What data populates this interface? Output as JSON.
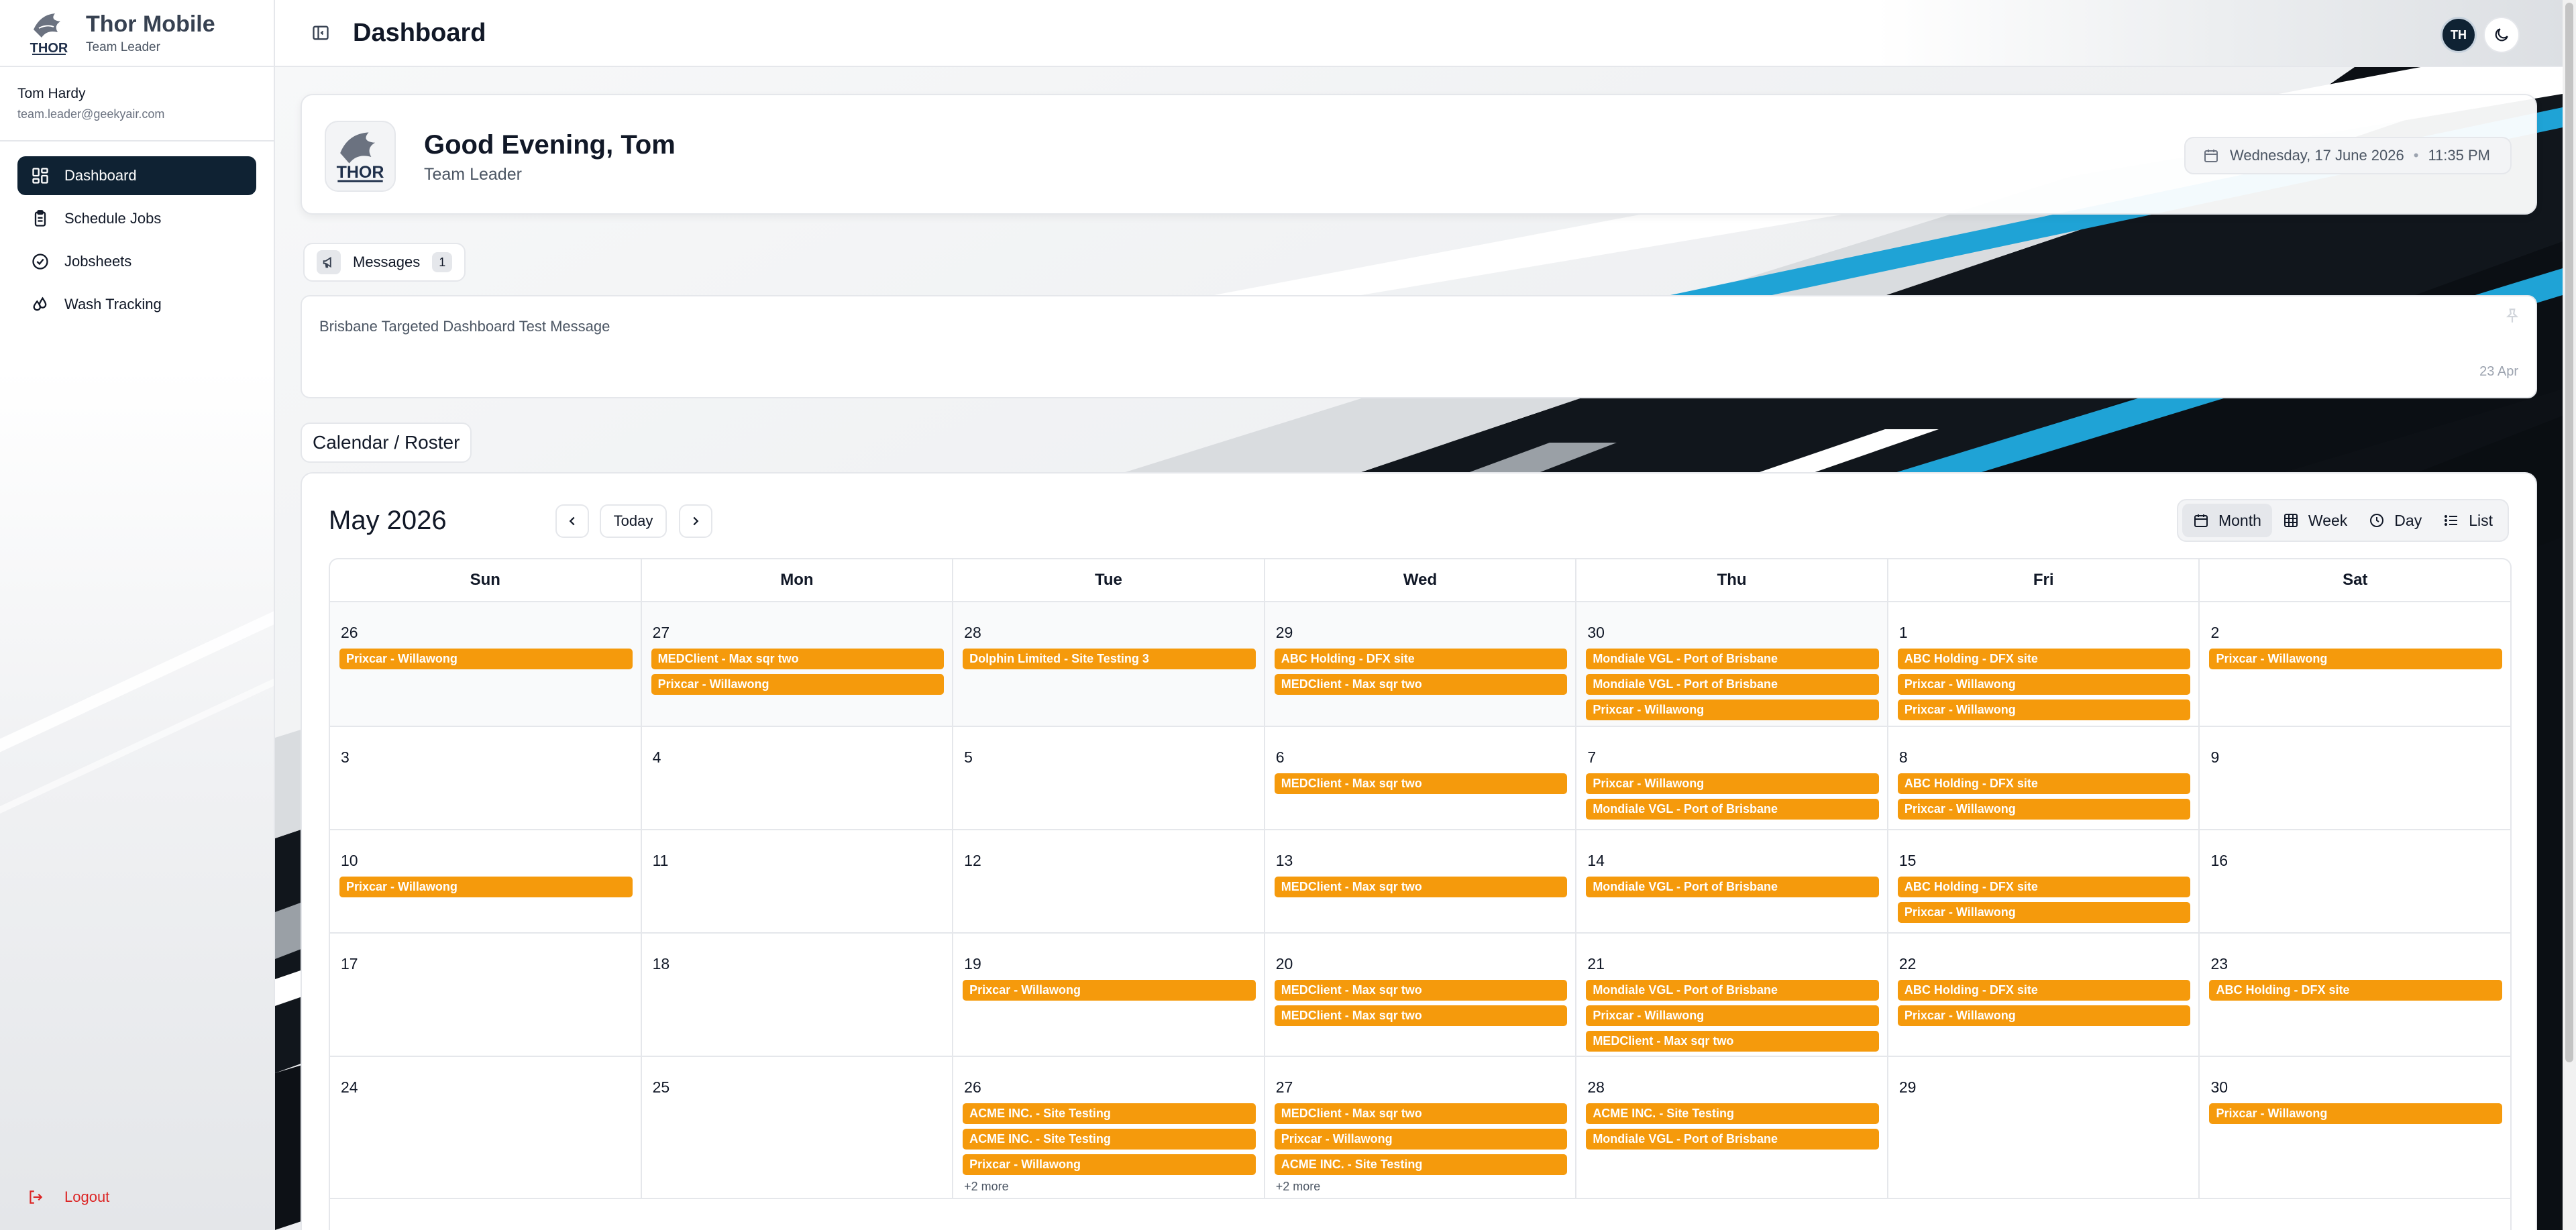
{
  "app": {
    "name": "Thor Mobile",
    "role": "Team Leader",
    "logo_text": "THOR"
  },
  "user": {
    "name": "Tom Hardy",
    "email": "team.leader@geekyair.com",
    "initials": "TH"
  },
  "sidebar": {
    "items": [
      {
        "label": "Dashboard",
        "icon": "dashboard-icon",
        "active": true
      },
      {
        "label": "Schedule Jobs",
        "icon": "clipboard-icon",
        "active": false
      },
      {
        "label": "Jobsheets",
        "icon": "check-circle-icon",
        "active": false
      },
      {
        "label": "Wash Tracking",
        "icon": "droplets-icon",
        "active": false
      }
    ],
    "logout_label": "Logout"
  },
  "topbar": {
    "title": "Dashboard"
  },
  "greeting": {
    "title": "Good Evening, Tom",
    "subtitle": "Team Leader",
    "date": "Wednesday, 17 June 2026",
    "time": "11:35 PM",
    "separator": "•"
  },
  "messages": {
    "label": "Messages",
    "count": "1",
    "items": [
      {
        "text": "Brisbane Targeted Dashboard Test Message",
        "date": "23 Apr"
      }
    ]
  },
  "calendar": {
    "section_label": "Calendar / Roster",
    "title": "May 2026",
    "today_label": "Today",
    "views": [
      {
        "label": "Month",
        "icon": "calendar-icon",
        "active": true
      },
      {
        "label": "Week",
        "icon": "grid-icon",
        "active": false
      },
      {
        "label": "Day",
        "icon": "clock-icon",
        "active": false
      },
      {
        "label": "List",
        "icon": "list-icon",
        "active": false
      }
    ],
    "weekdays": [
      "Sun",
      "Mon",
      "Tue",
      "Wed",
      "Thu",
      "Fri",
      "Sat"
    ],
    "event_color": "#f59a0c",
    "weeks": [
      [
        {
          "day": "26",
          "outside": true,
          "events": [
            "Prixcar - Willawong"
          ]
        },
        {
          "day": "27",
          "outside": true,
          "events": [
            "MEDClient - Max sqr two",
            "Prixcar - Willawong"
          ]
        },
        {
          "day": "28",
          "outside": true,
          "events": [
            "Dolphin Limited - Site Testing 3"
          ]
        },
        {
          "day": "29",
          "outside": true,
          "events": [
            "ABC Holding - DFX site",
            "MEDClient - Max sqr two"
          ]
        },
        {
          "day": "30",
          "outside": true,
          "events": [
            "Mondiale VGL - Port of Brisbane",
            "Mondiale VGL - Port of Brisbane",
            "Prixcar - Willawong"
          ]
        },
        {
          "day": "1",
          "outside": false,
          "events": [
            "ABC Holding - DFX site",
            "Prixcar - Willawong",
            "Prixcar - Willawong"
          ]
        },
        {
          "day": "2",
          "outside": false,
          "events": [
            "Prixcar - Willawong"
          ]
        }
      ],
      [
        {
          "day": "3",
          "outside": false,
          "events": []
        },
        {
          "day": "4",
          "outside": false,
          "events": []
        },
        {
          "day": "5",
          "outside": false,
          "events": []
        },
        {
          "day": "6",
          "outside": false,
          "events": [
            "MEDClient - Max sqr two"
          ]
        },
        {
          "day": "7",
          "outside": false,
          "events": [
            "Prixcar - Willawong",
            "Mondiale VGL - Port of Brisbane"
          ]
        },
        {
          "day": "8",
          "outside": false,
          "events": [
            "ABC Holding - DFX site",
            "Prixcar - Willawong"
          ]
        },
        {
          "day": "9",
          "outside": false,
          "events": []
        }
      ],
      [
        {
          "day": "10",
          "outside": false,
          "events": [
            "Prixcar - Willawong"
          ]
        },
        {
          "day": "11",
          "outside": false,
          "events": []
        },
        {
          "day": "12",
          "outside": false,
          "events": []
        },
        {
          "day": "13",
          "outside": false,
          "events": [
            "MEDClient - Max sqr two"
          ]
        },
        {
          "day": "14",
          "outside": false,
          "events": [
            "Mondiale VGL - Port of Brisbane"
          ]
        },
        {
          "day": "15",
          "outside": false,
          "events": [
            "ABC Holding - DFX site",
            "Prixcar - Willawong"
          ]
        },
        {
          "day": "16",
          "outside": false,
          "events": []
        }
      ],
      [
        {
          "day": "17",
          "outside": false,
          "events": []
        },
        {
          "day": "18",
          "outside": false,
          "events": []
        },
        {
          "day": "19",
          "outside": false,
          "events": [
            "Prixcar - Willawong"
          ]
        },
        {
          "day": "20",
          "outside": false,
          "events": [
            "MEDClient - Max sqr two",
            "MEDClient - Max sqr two"
          ]
        },
        {
          "day": "21",
          "outside": false,
          "events": [
            "Mondiale VGL - Port of Brisbane",
            "Prixcar - Willawong",
            "MEDClient - Max sqr two"
          ]
        },
        {
          "day": "22",
          "outside": false,
          "events": [
            "ABC Holding - DFX site",
            "Prixcar - Willawong"
          ]
        },
        {
          "day": "23",
          "outside": false,
          "events": [
            "ABC Holding - DFX site"
          ]
        }
      ],
      [
        {
          "day": "24",
          "outside": false,
          "events": []
        },
        {
          "day": "25",
          "outside": false,
          "events": []
        },
        {
          "day": "26",
          "outside": false,
          "events": [
            "ACME INC. - Site Testing",
            "ACME INC. - Site Testing",
            "Prixcar - Willawong"
          ],
          "more": "+2 more"
        },
        {
          "day": "27",
          "outside": false,
          "events": [
            "MEDClient - Max sqr two",
            "Prixcar - Willawong",
            "ACME INC. - Site Testing"
          ],
          "more": "+2 more"
        },
        {
          "day": "28",
          "outside": false,
          "events": [
            "ACME INC. - Site Testing",
            "Mondiale VGL - Port of Brisbane"
          ]
        },
        {
          "day": "29",
          "outside": false,
          "events": []
        },
        {
          "day": "30",
          "outside": false,
          "events": [
            "Prixcar - Willawong"
          ]
        }
      ]
    ]
  }
}
